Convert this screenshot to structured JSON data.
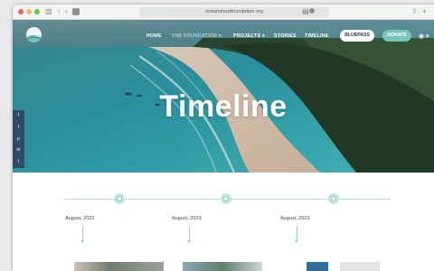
{
  "browser": {
    "url": "oceanstrustfoundation.org",
    "icons": {
      "sidebar": "sidebar-icon",
      "back": "chevron-left-icon",
      "forward": "chevron-right-icon",
      "lock": "lock-icon",
      "share": "share-icon",
      "new_tab": "plus-icon"
    }
  },
  "nav": {
    "logo_text": "",
    "items": [
      {
        "label": "HOME"
      },
      {
        "label": "THE FOUNDATION ▾"
      },
      {
        "label": "PROJECTS ▾"
      },
      {
        "label": "STORIES"
      },
      {
        "label": "TIMELINE"
      }
    ],
    "bluepass_label": "BLUEPASS",
    "donate_label": "DONATE",
    "accent_color": "#78c6b9"
  },
  "hero": {
    "title": "Timeline"
  },
  "social": [
    "f",
    "t",
    "p",
    "in",
    "t"
  ],
  "timeline": {
    "entries": [
      {
        "date": "August, 2023"
      },
      {
        "date": "August, 2023"
      },
      {
        "date": "August, 2023"
      }
    ]
  }
}
